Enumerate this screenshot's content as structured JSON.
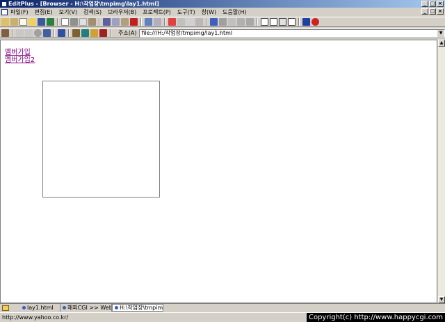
{
  "titlebar": {
    "title": "EditPlus - [Browser - H:\\작업장\\tmpimg\\lay1.html]"
  },
  "window_buttons": [
    "_",
    "□",
    "×"
  ],
  "menu": {
    "items": [
      "파일(F)",
      "편집(E)",
      "보기(V)",
      "검색(S)",
      "브라우저(B)",
      "프로젝트(P)",
      "도구(T)",
      "창(W)",
      "도움말(H)"
    ]
  },
  "address": {
    "label": "주소(A)",
    "value": "file:///H:/작업장/tmpimg/lay1.html",
    "drop_glyph": "▼"
  },
  "content": {
    "link1": "멤버가입",
    "link2": "멤버가입2"
  },
  "scrollbar": {
    "up_glyph": "▲",
    "down_glyph": "▼"
  },
  "tabs": [
    "lay1.html",
    "해피CGI >> WebPr",
    "H:\\작업장\\tmpim"
  ],
  "status": {
    "text": "http://www.yahoo.co.kr/",
    "copyright": "Copyright(c) http://www.happycgi.com"
  },
  "colors": {
    "title_start": "#0a246a",
    "title_end": "#a6caf0",
    "link_visited": "#800080",
    "chrome": "#d4d0c8"
  },
  "icons": {
    "tb1": [
      "new-icon",
      "open-icon",
      "save-icon",
      "save-all-icon",
      "print-icon",
      "preview-icon",
      "spell-icon",
      "cut-icon",
      "copy-icon",
      "paste-icon",
      "delete-icon",
      "undo-icon",
      "redo-icon",
      "find-icon",
      "replace-icon",
      "goto-icon",
      "font-icon",
      "word-wrap-icon",
      "ruler-icon",
      "line-number-icon",
      "column-icon",
      "window-icon",
      "browser-icon",
      "help-icon",
      "stop-icon"
    ],
    "tb2": [
      "pen-icon",
      "back-icon",
      "forward-icon",
      "refresh-icon",
      "zoom-icon",
      "font-size-icon",
      "home-icon",
      "web-icon",
      "favorite-icon",
      "bookmark-icon"
    ]
  }
}
